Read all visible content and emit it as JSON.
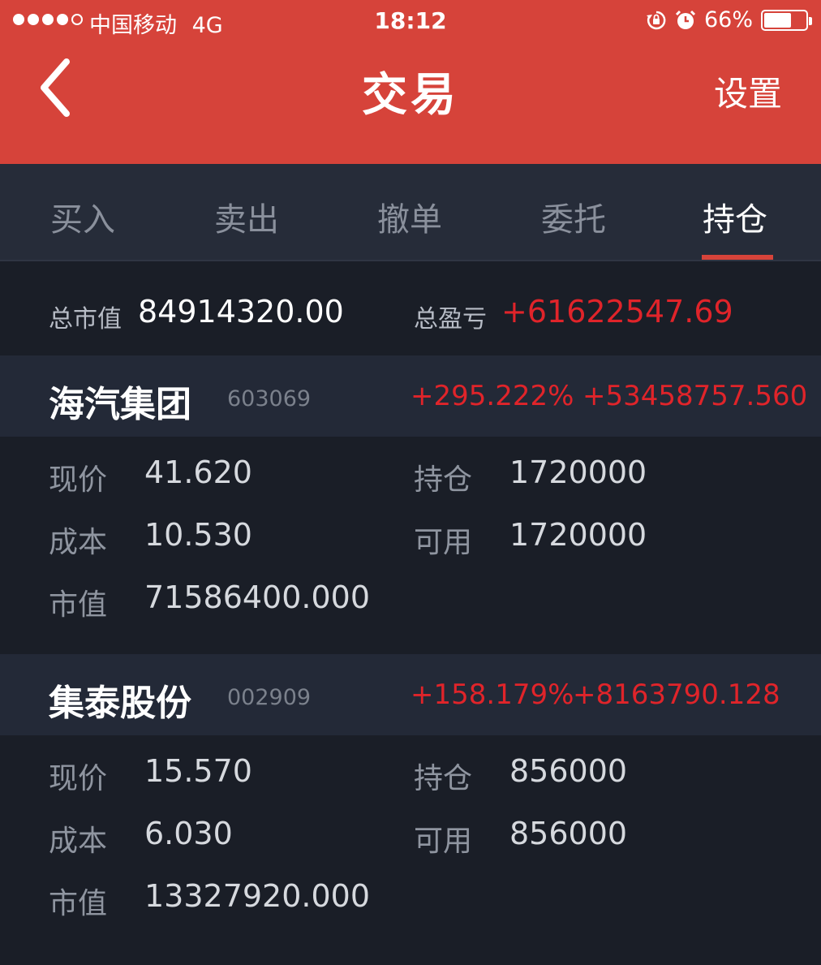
{
  "status_bar": {
    "carrier": "中国移动",
    "network": "4G",
    "time": "18:12",
    "battery": "66%",
    "battery_level": 0.66
  },
  "nav": {
    "title": "交易",
    "settings_label": "设置"
  },
  "tabs": [
    {
      "label": "买入",
      "active": false
    },
    {
      "label": "卖出",
      "active": false
    },
    {
      "label": "撤单",
      "active": false
    },
    {
      "label": "委托",
      "active": false
    },
    {
      "label": "持仓",
      "active": true
    }
  ],
  "summary": {
    "market_value_label": "总市值",
    "market_value": "84914320.00",
    "profit_label": "总盈亏",
    "profit": "+61622547.69"
  },
  "labels": {
    "price": "现价",
    "cost": "成本",
    "value": "市值",
    "holding": "持仓",
    "available": "可用"
  },
  "positions": [
    {
      "name": "海汽集团",
      "code": "603069",
      "pct": "+295.222%",
      "pnl": "+53458757.560",
      "price": "41.620",
      "cost": "10.530",
      "value": "71586400.000",
      "holding": "1720000",
      "available": "1720000"
    },
    {
      "name": "集泰股份",
      "code": "002909",
      "pct": "+158.179%",
      "pnl": "+8163790.128",
      "price": "15.570",
      "cost": "6.030",
      "value": "13327920.000",
      "holding": "856000",
      "available": "856000"
    }
  ],
  "colors": {
    "header": "#d6433a",
    "gain": "#e0242a",
    "background": "#1a1e27"
  }
}
